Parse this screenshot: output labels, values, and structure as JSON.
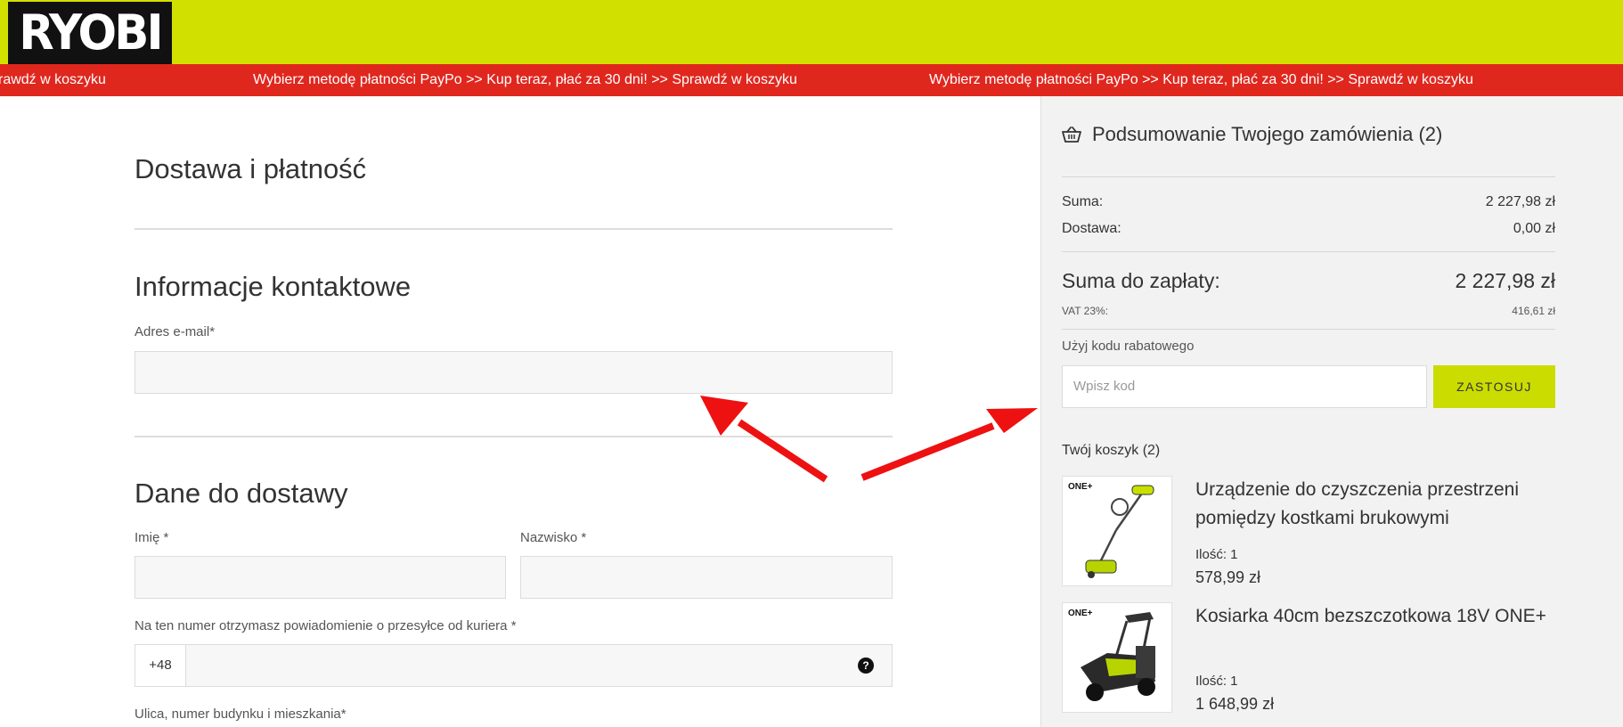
{
  "header": {
    "logo_text": "RYOBI",
    "bg_color": "#d2e000"
  },
  "promo": {
    "left_fragment": "rawdź w koszyku",
    "message": "Wybierz metodę płatności PayPo >> Kup teraz, płać za 30 dni! >> Sprawdź w koszyku",
    "bg_color": "#e0271e"
  },
  "checkout": {
    "title": "Dostawa i płatność",
    "contact": {
      "heading": "Informacje kontaktowe",
      "email_label": "Adres e-mail*"
    },
    "delivery": {
      "heading": "Dane do dostawy",
      "first_name_label": "Imię *",
      "last_name_label": "Nazwisko *",
      "phone_label": "Na ten numer otrzymasz powiadomienie o przesyłce od kuriera *",
      "phone_prefix": "+48",
      "help_icon": "?",
      "street_label": "Ulica, numer budynku i mieszkania*"
    }
  },
  "summary": {
    "title": "Podsumowanie Twojego zamówienia (2)",
    "subtotal_label": "Suma:",
    "subtotal_value": "2 227,98 zł",
    "shipping_label": "Dostawa:",
    "shipping_value": "0,00 zł",
    "total_label": "Suma do zapłaty:",
    "total_value": "2 227,98 zł",
    "vat_label": "VAT 23%:",
    "vat_value": "416,61 zł",
    "coupon_label": "Użyj kodu rabatowego",
    "coupon_placeholder": "Wpisz kod",
    "coupon_button": "ZASTOSUJ",
    "cart_title": "Twój koszyk (2)",
    "products": [
      {
        "name": "Urządzenie do czyszczenia przestrzeni pomiędzy kostkami brukowymi",
        "qty": "Ilość: 1",
        "price": "578,99 zł",
        "badge": "ONE+"
      },
      {
        "name": "Kosiarka 40cm bezszczotkowa 18V ONE+",
        "qty": "Ilość: 1",
        "price": "1 648,99 zł",
        "badge": "ONE+"
      }
    ]
  },
  "colors": {
    "accent": "#cbdc00",
    "arrow": "#ee1111"
  },
  "icons": {
    "basket": "basket-icon",
    "help": "question-circle-icon"
  }
}
